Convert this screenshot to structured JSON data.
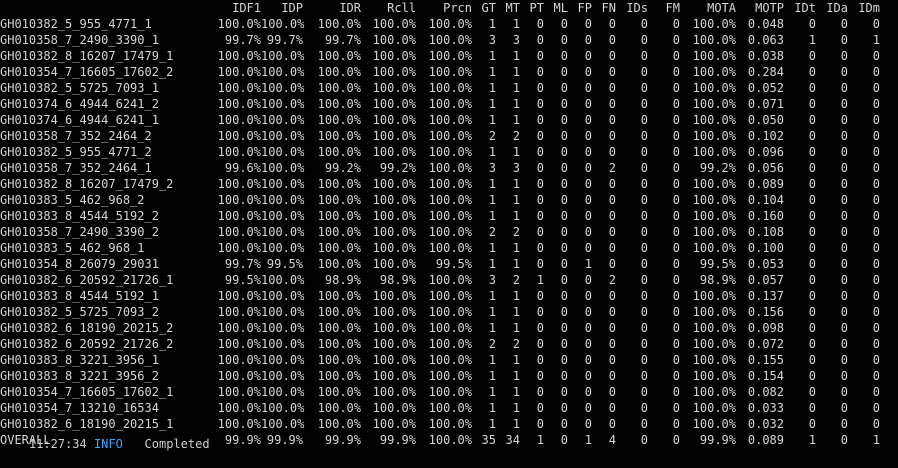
{
  "terminal": {
    "headers": [
      "IDF1",
      "IDP",
      "IDR",
      "Rcll",
      "Prcn",
      "GT",
      "MT",
      "PT",
      "ML",
      "FP",
      "FN",
      "IDs",
      "FM",
      "MOTA",
      "MOTP",
      "IDt",
      "IDa",
      "IDm"
    ],
    "rows": [
      [
        "GH010382_5_955_4771_1",
        "100.0%",
        "100.0%",
        "100.0%",
        "100.0%",
        "100.0%",
        "1",
        "1",
        "0",
        "0",
        "0",
        "0",
        "0",
        "0",
        "100.0%",
        "0.048",
        "0",
        "0",
        "0"
      ],
      [
        "GH010358_7_2490_3390_1",
        "99.7%",
        "99.7%",
        "99.7%",
        "100.0%",
        "100.0%",
        "3",
        "3",
        "0",
        "0",
        "0",
        "0",
        "0",
        "0",
        "100.0%",
        "0.063",
        "1",
        "0",
        "1"
      ],
      [
        "GH010382_8_16207_17479_1",
        "100.0%",
        "100.0%",
        "100.0%",
        "100.0%",
        "100.0%",
        "1",
        "1",
        "0",
        "0",
        "0",
        "0",
        "0",
        "0",
        "100.0%",
        "0.038",
        "0",
        "0",
        "0"
      ],
      [
        "GH010354_7_16605_17602_2",
        "100.0%",
        "100.0%",
        "100.0%",
        "100.0%",
        "100.0%",
        "1",
        "1",
        "0",
        "0",
        "0",
        "0",
        "0",
        "0",
        "100.0%",
        "0.284",
        "0",
        "0",
        "0"
      ],
      [
        "GH010382_5_5725_7093_1",
        "100.0%",
        "100.0%",
        "100.0%",
        "100.0%",
        "100.0%",
        "1",
        "1",
        "0",
        "0",
        "0",
        "0",
        "0",
        "0",
        "100.0%",
        "0.052",
        "0",
        "0",
        "0"
      ],
      [
        "GH010374_6_4944_6241_2",
        "100.0%",
        "100.0%",
        "100.0%",
        "100.0%",
        "100.0%",
        "1",
        "1",
        "0",
        "0",
        "0",
        "0",
        "0",
        "0",
        "100.0%",
        "0.071",
        "0",
        "0",
        "0"
      ],
      [
        "GH010374_6_4944_6241_1",
        "100.0%",
        "100.0%",
        "100.0%",
        "100.0%",
        "100.0%",
        "1",
        "1",
        "0",
        "0",
        "0",
        "0",
        "0",
        "0",
        "100.0%",
        "0.050",
        "0",
        "0",
        "0"
      ],
      [
        "GH010358_7_352_2464_2",
        "100.0%",
        "100.0%",
        "100.0%",
        "100.0%",
        "100.0%",
        "2",
        "2",
        "0",
        "0",
        "0",
        "0",
        "0",
        "0",
        "100.0%",
        "0.102",
        "0",
        "0",
        "0"
      ],
      [
        "GH010382_5_955_4771_2",
        "100.0%",
        "100.0%",
        "100.0%",
        "100.0%",
        "100.0%",
        "1",
        "1",
        "0",
        "0",
        "0",
        "0",
        "0",
        "0",
        "100.0%",
        "0.096",
        "0",
        "0",
        "0"
      ],
      [
        "GH010358_7_352_2464_1",
        "99.6%",
        "100.0%",
        "99.2%",
        "99.2%",
        "100.0%",
        "3",
        "3",
        "0",
        "0",
        "0",
        "2",
        "0",
        "0",
        "99.2%",
        "0.056",
        "0",
        "0",
        "0"
      ],
      [
        "GH010382_8_16207_17479_2",
        "100.0%",
        "100.0%",
        "100.0%",
        "100.0%",
        "100.0%",
        "1",
        "1",
        "0",
        "0",
        "0",
        "0",
        "0",
        "0",
        "100.0%",
        "0.089",
        "0",
        "0",
        "0"
      ],
      [
        "GH010383_5_462_968_2",
        "100.0%",
        "100.0%",
        "100.0%",
        "100.0%",
        "100.0%",
        "1",
        "1",
        "0",
        "0",
        "0",
        "0",
        "0",
        "0",
        "100.0%",
        "0.104",
        "0",
        "0",
        "0"
      ],
      [
        "GH010383_8_4544_5192_2",
        "100.0%",
        "100.0%",
        "100.0%",
        "100.0%",
        "100.0%",
        "1",
        "1",
        "0",
        "0",
        "0",
        "0",
        "0",
        "0",
        "100.0%",
        "0.160",
        "0",
        "0",
        "0"
      ],
      [
        "GH010358_7_2490_3390_2",
        "100.0%",
        "100.0%",
        "100.0%",
        "100.0%",
        "100.0%",
        "2",
        "2",
        "0",
        "0",
        "0",
        "0",
        "0",
        "0",
        "100.0%",
        "0.108",
        "0",
        "0",
        "0"
      ],
      [
        "GH010383_5_462_968_1",
        "100.0%",
        "100.0%",
        "100.0%",
        "100.0%",
        "100.0%",
        "1",
        "1",
        "0",
        "0",
        "0",
        "0",
        "0",
        "0",
        "100.0%",
        "0.100",
        "0",
        "0",
        "0"
      ],
      [
        "GH010354_8_26079_29031",
        "99.7%",
        "99.5%",
        "100.0%",
        "100.0%",
        "99.5%",
        "1",
        "1",
        "0",
        "0",
        "1",
        "0",
        "0",
        "0",
        "99.5%",
        "0.053",
        "0",
        "0",
        "0"
      ],
      [
        "GH010382_6_20592_21726_1",
        "99.5%",
        "100.0%",
        "98.9%",
        "98.9%",
        "100.0%",
        "3",
        "2",
        "1",
        "0",
        "0",
        "2",
        "0",
        "0",
        "98.9%",
        "0.057",
        "0",
        "0",
        "0"
      ],
      [
        "GH010383_8_4544_5192_1",
        "100.0%",
        "100.0%",
        "100.0%",
        "100.0%",
        "100.0%",
        "1",
        "1",
        "0",
        "0",
        "0",
        "0",
        "0",
        "0",
        "100.0%",
        "0.137",
        "0",
        "0",
        "0"
      ],
      [
        "GH010382_5_5725_7093_2",
        "100.0%",
        "100.0%",
        "100.0%",
        "100.0%",
        "100.0%",
        "1",
        "1",
        "0",
        "0",
        "0",
        "0",
        "0",
        "0",
        "100.0%",
        "0.156",
        "0",
        "0",
        "0"
      ],
      [
        "GH010382_6_18190_20215_2",
        "100.0%",
        "100.0%",
        "100.0%",
        "100.0%",
        "100.0%",
        "1",
        "1",
        "0",
        "0",
        "0",
        "0",
        "0",
        "0",
        "100.0%",
        "0.098",
        "0",
        "0",
        "0"
      ],
      [
        "GH010382_6_20592_21726_2",
        "100.0%",
        "100.0%",
        "100.0%",
        "100.0%",
        "100.0%",
        "2",
        "2",
        "0",
        "0",
        "0",
        "0",
        "0",
        "0",
        "100.0%",
        "0.072",
        "0",
        "0",
        "0"
      ],
      [
        "GH010383_8_3221_3956_1",
        "100.0%",
        "100.0%",
        "100.0%",
        "100.0%",
        "100.0%",
        "1",
        "1",
        "0",
        "0",
        "0",
        "0",
        "0",
        "0",
        "100.0%",
        "0.155",
        "0",
        "0",
        "0"
      ],
      [
        "GH010383_8_3221_3956_2",
        "100.0%",
        "100.0%",
        "100.0%",
        "100.0%",
        "100.0%",
        "1",
        "1",
        "0",
        "0",
        "0",
        "0",
        "0",
        "0",
        "100.0%",
        "0.154",
        "0",
        "0",
        "0"
      ],
      [
        "GH010354_7_16605_17602_1",
        "100.0%",
        "100.0%",
        "100.0%",
        "100.0%",
        "100.0%",
        "1",
        "1",
        "0",
        "0",
        "0",
        "0",
        "0",
        "0",
        "100.0%",
        "0.082",
        "0",
        "0",
        "0"
      ],
      [
        "GH010354_7_13210_16534",
        "100.0%",
        "100.0%",
        "100.0%",
        "100.0%",
        "100.0%",
        "1",
        "1",
        "0",
        "0",
        "0",
        "0",
        "0",
        "0",
        "100.0%",
        "0.033",
        "0",
        "0",
        "0"
      ],
      [
        "GH010382_6_18190_20215_1",
        "100.0%",
        "100.0%",
        "100.0%",
        "100.0%",
        "100.0%",
        "1",
        "1",
        "0",
        "0",
        "0",
        "0",
        "0",
        "0",
        "100.0%",
        "0.032",
        "0",
        "0",
        "0"
      ],
      [
        "OVERALL",
        "99.9%",
        "99.9%",
        "99.9%",
        "99.9%",
        "100.0%",
        "35",
        "34",
        "1",
        "0",
        "1",
        "4",
        "0",
        "0",
        "99.9%",
        "0.089",
        "1",
        "0",
        "1"
      ]
    ],
    "footer": {
      "prefix": "11:27:34 ",
      "level": "INFO",
      "message": "   Completed"
    },
    "colors": {
      "background": "#000000",
      "text": "#d7d7d7",
      "info": "#3aa7ff"
    }
  }
}
